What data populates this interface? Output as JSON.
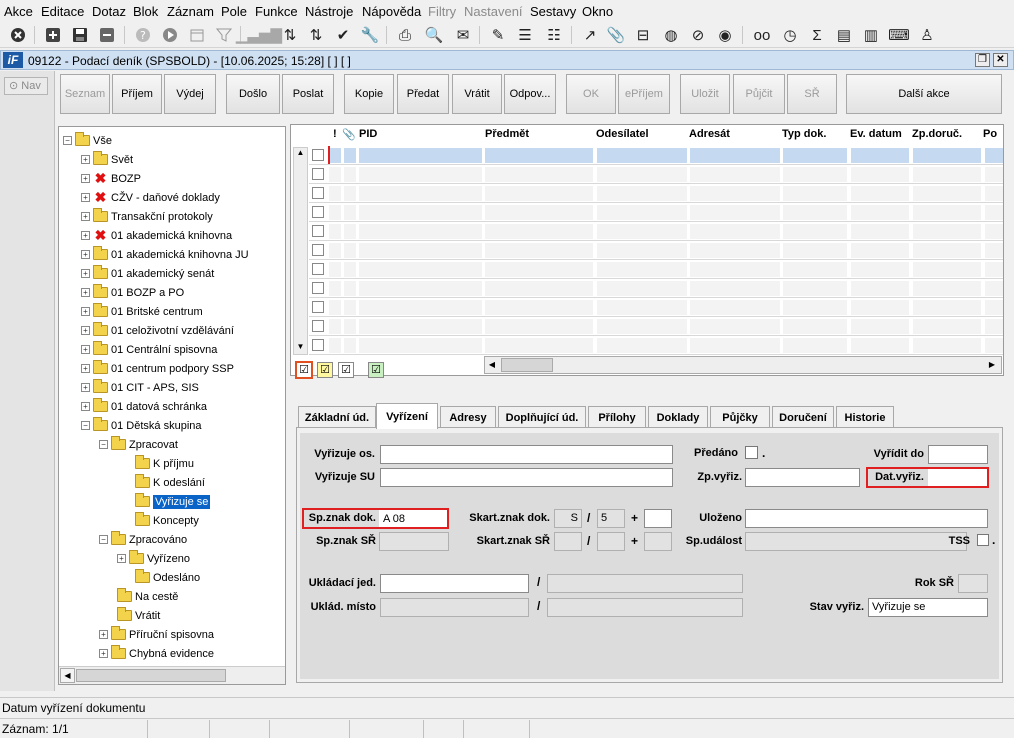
{
  "menu": [
    "Akce",
    "Editace",
    "Dotaz",
    "Blok",
    "Záznam",
    "Pole",
    "Funkce",
    "Nástroje",
    "Nápověda",
    "Filtry",
    "Nastavení",
    "Sestavy",
    "Okno"
  ],
  "menu_disabled": [
    "Filtry",
    "Nastavení"
  ],
  "window": {
    "title": "09122 - Podací deník (SPSBOLD) - [10.06.2025; 15:28]  [ ]  [ ]",
    "logo": "iF"
  },
  "nav_label": "Nav",
  "actions": {
    "seznam": "Seznam",
    "prijem": "Příjem",
    "vydej": "Výdej",
    "doslo": "Došlo",
    "poslat": "Poslat",
    "kopie": "Kopie",
    "predat": "Předat",
    "vratit": "Vrátit",
    "odpov": "Odpov...",
    "ok": "OK",
    "eprijem": "ePříjem",
    "ulozit": "Uložit",
    "pujcit": "Půjčit",
    "sr": "SŘ",
    "dalsi": "Další akce"
  },
  "tree": {
    "items": [
      {
        "label": "Vše"
      },
      {
        "label": "Svět"
      },
      {
        "label": "BOZP"
      },
      {
        "label": "CŽV - daňové doklady"
      },
      {
        "label": "Transakční protokoly"
      },
      {
        "label": "01 akademická knihovna"
      },
      {
        "label": "01 akademická knihovna JU"
      },
      {
        "label": "01 akademický senát"
      },
      {
        "label": "01 BOZP a PO"
      },
      {
        "label": "01 Britské centrum"
      },
      {
        "label": "01 celoživotní vzdělávání"
      },
      {
        "label": "01 Centrální spisovna"
      },
      {
        "label": "01 centrum podpory SSP"
      },
      {
        "label": "01 CIT - APS, SIS"
      },
      {
        "label": "01 datová schránka"
      },
      {
        "label": "01 Dětská skupina"
      },
      {
        "label": "Zpracovat"
      },
      {
        "label": "K příjmu"
      },
      {
        "label": "K odeslání"
      },
      {
        "label": "Vyřizuje se"
      },
      {
        "label": "Koncepty"
      },
      {
        "label": "Zpracováno"
      },
      {
        "label": "Vyřízeno"
      },
      {
        "label": "Odesláno"
      },
      {
        "label": "Na cestě"
      },
      {
        "label": "Vrátit"
      },
      {
        "label": "Příruční spisovna"
      },
      {
        "label": "Chybná evidence"
      }
    ]
  },
  "grid": {
    "columns": {
      "excl": "!",
      "attach": "📎",
      "pid": "PID",
      "predmet": "Předmět",
      "odesilatel": "Odesílatel",
      "adresat": "Adresát",
      "typ": "Typ dok.",
      "evdatum": "Ev. datum",
      "zpdoruc": "Zp.doruč.",
      "po": "Po"
    }
  },
  "tabs": [
    "Základní úd.",
    "Vyřízení",
    "Adresy",
    "Doplňující úd.",
    "Přílohy",
    "Doklady",
    "Půjčky",
    "Doručení",
    "Historie"
  ],
  "active_tab": "Vyřízení",
  "form": {
    "vyrizuje_os": "Vyřizuje os.",
    "vyrizuje_su": "Vyřizuje SU",
    "predano": "Předáno",
    "vyridit_do": "Vyřídit do",
    "zp_vyriz": "Zp.vyřiz.",
    "dat_vyriz": "Dat.vyřiz.",
    "sp_znak_dok": "Sp.znak dok.",
    "sp_znak_dok_value": "A 08",
    "skart_znak_dok": "Skart.znak dok.",
    "skart_znak_dok_value": "S",
    "skart_lhuta_value": "5",
    "ulozeno": "Uloženo",
    "sp_znak_sr": "Sp.znak SŘ",
    "skart_znak_sr": "Skart.znak SŘ",
    "sp_udalost": "Sp.událost",
    "tss": "TSS",
    "ukladaci_jed": "Ukládací jed.",
    "rok_sr": "Rok SŘ",
    "uklad_misto": "Uklád. místo",
    "stav_vyriz": "Stav vyřiz.",
    "stav_vyriz_value": "Vyřizuje se",
    "slash": "/",
    "plus": "+",
    "dot": "."
  },
  "status": {
    "hint": "Datum vyřízení dokumentu",
    "record": "Záznam: 1/1"
  },
  "colors": {
    "highlight": "#e02020",
    "selection": "#0a64c8",
    "title_bar": "#cfe0f2"
  }
}
